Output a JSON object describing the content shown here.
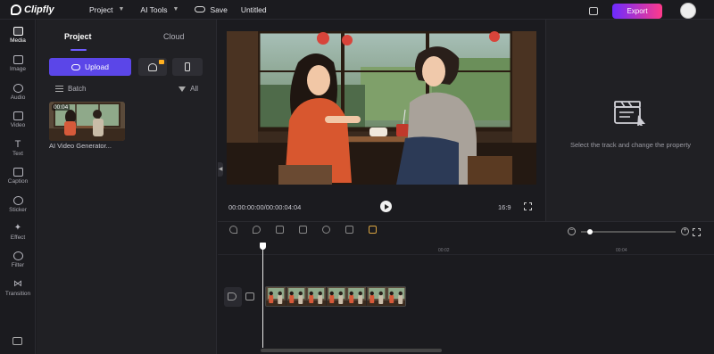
{
  "app": {
    "name": "Clipfly"
  },
  "topbar": {
    "project_menu": "Project",
    "ai_tools_menu": "AI Tools",
    "save_label": "Save",
    "document_title": "Untitled",
    "export_label": "Export"
  },
  "rail": {
    "items": [
      {
        "label": "Media",
        "icon": "media-icon"
      },
      {
        "label": "Image",
        "icon": "image-icon"
      },
      {
        "label": "Audio",
        "icon": "audio-icon"
      },
      {
        "label": "Video",
        "icon": "video-icon"
      },
      {
        "label": "Text",
        "icon": "text-icon"
      },
      {
        "label": "Caption",
        "icon": "caption-icon"
      },
      {
        "label": "Sticker",
        "icon": "sticker-icon"
      },
      {
        "label": "Effect",
        "icon": "effect-icon"
      },
      {
        "label": "Filter",
        "icon": "filter-icon"
      },
      {
        "label": "Transition",
        "icon": "transition-icon"
      }
    ]
  },
  "media_panel": {
    "tabs": [
      "Project",
      "Cloud"
    ],
    "upload_label": "Upload",
    "batch_label": "Batch",
    "filter_label": "All",
    "assets": [
      {
        "name": "AI Video Generator...",
        "duration": "00:04"
      }
    ]
  },
  "preview": {
    "timecode": "00:00:00:00/00:00:04:04",
    "aspect_ratio": "16:9"
  },
  "properties": {
    "empty_text": "Select the track and change the property"
  },
  "timeline": {
    "ruler_marks": [
      "00:02",
      "00:04"
    ],
    "clip_frames": 7,
    "zoom_level": 0.07
  },
  "colors": {
    "accent": "#5b46e8",
    "export_gradient_start": "#6c2bff",
    "export_gradient_end": "#ff3a8a",
    "background": "#1b1b1f"
  }
}
